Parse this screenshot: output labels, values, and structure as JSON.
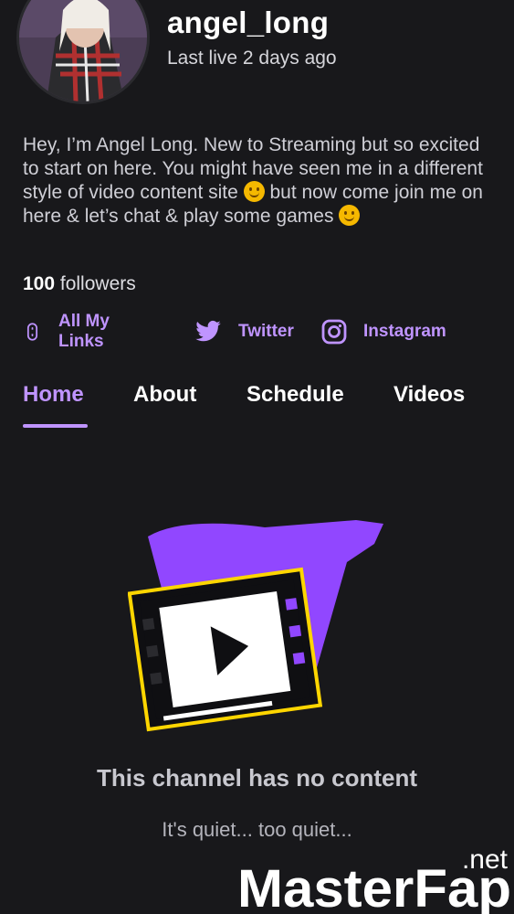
{
  "profile": {
    "username": "angel_long",
    "last_live": "Last live 2 days ago",
    "bio_part1": "Hey, I’m Angel Long. New to Streaming but so excited to start on here. You might have seen me in a different style of video content site ",
    "bio_emoji1": "wink-emoji",
    "bio_part2": "  but now come join me on here & let’s chat & play some games ",
    "bio_emoji2": "smile-emoji",
    "followers_count": "100",
    "followers_label": " followers"
  },
  "links": [
    {
      "label": "All My Links",
      "icon": "link-icon"
    },
    {
      "label": "Twitter",
      "icon": "twitter-icon"
    },
    {
      "label": "Instagram",
      "icon": "instagram-icon"
    }
  ],
  "tabs": [
    {
      "label": "Home",
      "active": true
    },
    {
      "label": "About",
      "active": false
    },
    {
      "label": "Schedule",
      "active": false
    },
    {
      "label": "Videos",
      "active": false
    }
  ],
  "empty_state": {
    "title": "This channel has no content",
    "subtitle": "It's quiet... too quiet...",
    "illustration": "film-play-icon"
  },
  "watermark": {
    "brand": "MasterFap",
    "tld": ".net"
  },
  "colors": {
    "background": "#18181b",
    "accent": "#bf94ff",
    "illustration_purple": "#9147ff",
    "illustration_yellow": "#ffd600"
  }
}
